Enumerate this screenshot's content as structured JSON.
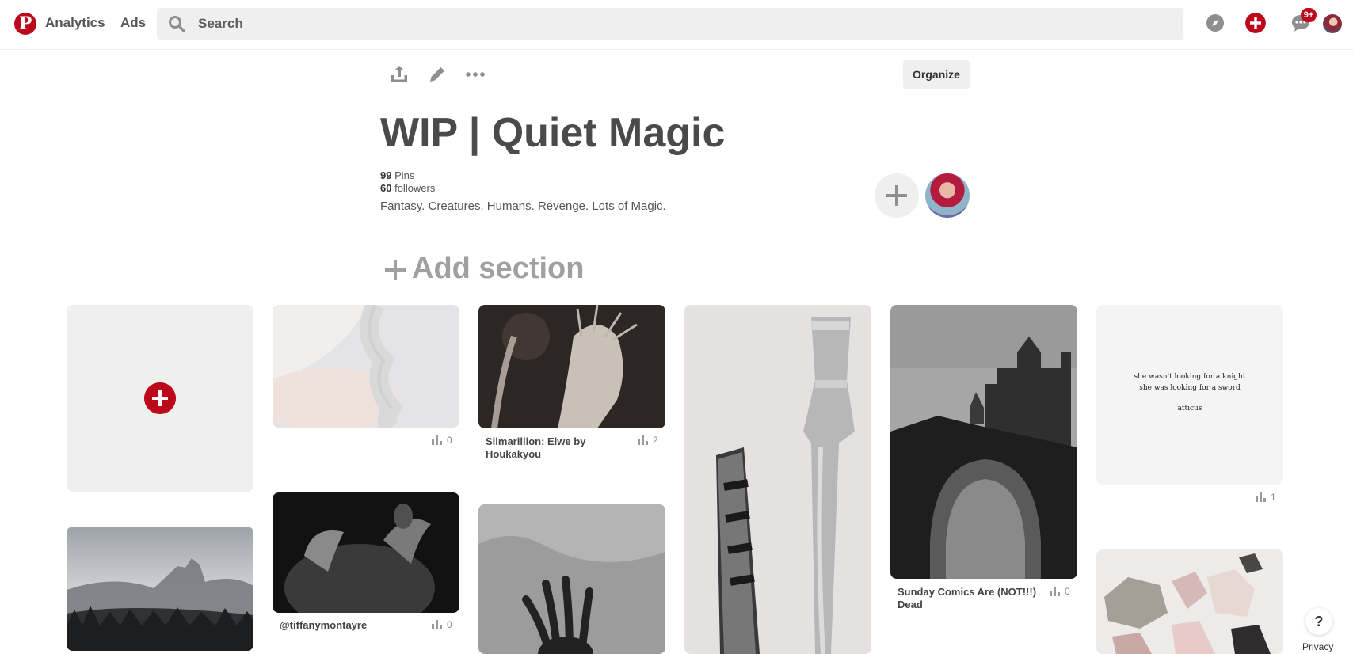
{
  "header": {
    "nav": [
      "Analytics",
      "Ads"
    ],
    "search_placeholder": "Search",
    "notifications_badge": "9+",
    "brand_color": "#bd081c"
  },
  "board": {
    "title": "WIP | Quiet Magic",
    "pins_count": "99",
    "pins_label": "Pins",
    "followers_count": "60",
    "followers_label": "followers",
    "description": "Fantasy. Creatures. Humans. Revenge. Lots of Magic.",
    "organize_label": "Organize",
    "add_section_label": "Add section"
  },
  "pins": [
    {
      "title": "",
      "count": "0"
    },
    {
      "title": "Silmarillion: Elwe by Houkakyou",
      "count": "2"
    },
    {
      "title": "Sunday Comics Are (NOT!!!) Dead",
      "count": "0"
    },
    {
      "title": "",
      "count": "1",
      "quote": [
        "she wasn't looking for a knight",
        "she was looking for a sword",
        "atticus"
      ]
    },
    {
      "title": "@tiffanymontayre",
      "count": "0"
    }
  ],
  "footer": {
    "help": "?",
    "privacy": "Privacy"
  },
  "icons": [
    "pinterest-logo-icon",
    "search-icon",
    "compass-icon",
    "plus-circle-icon",
    "chat-icon",
    "share-icon",
    "pencil-icon",
    "more-icon",
    "stats-icon",
    "plus-icon"
  ]
}
